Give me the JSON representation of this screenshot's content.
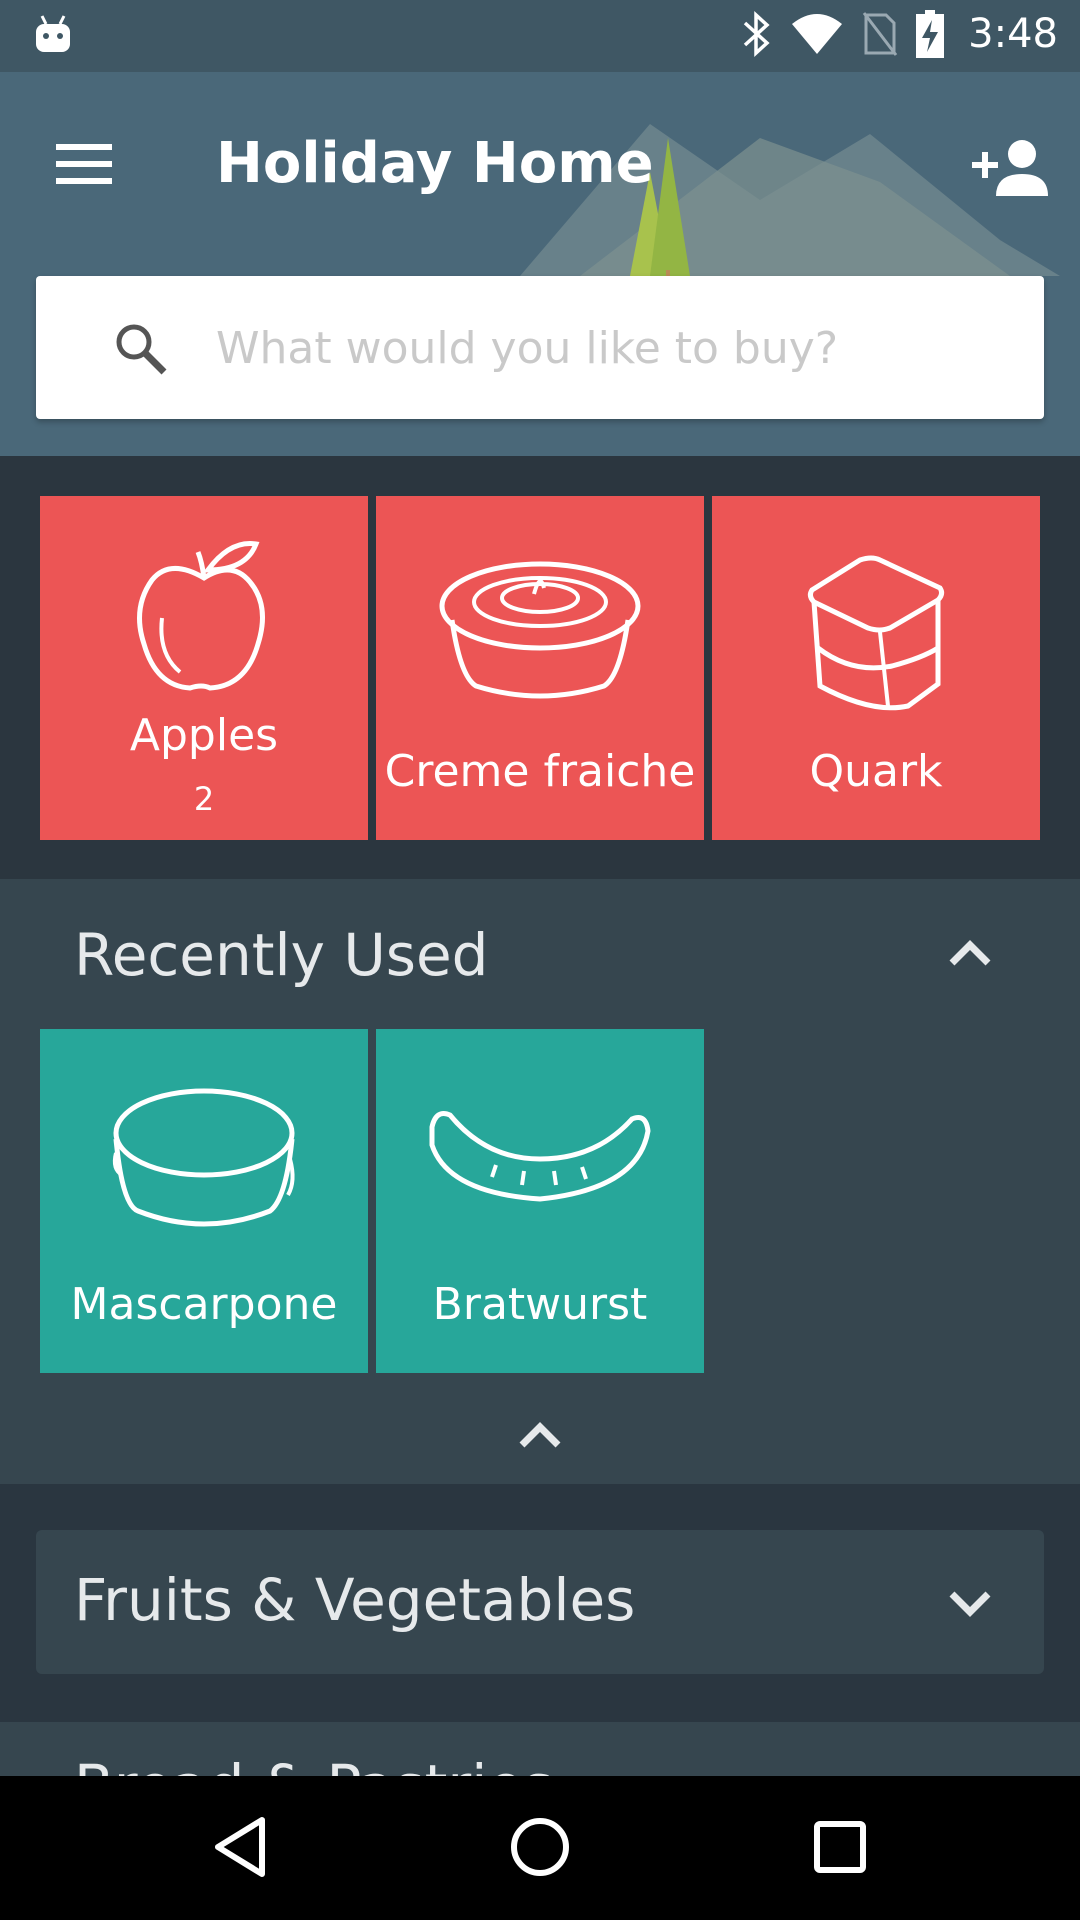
{
  "status_bar": {
    "time": "3:48",
    "icons": [
      "android-icon",
      "bluetooth-icon",
      "wifi-icon",
      "no-sim-icon",
      "battery-charging-icon"
    ]
  },
  "header": {
    "title": "Holiday Home",
    "menu_icon": "hamburger-menu-icon",
    "add_user_icon": "person-add-icon"
  },
  "search": {
    "placeholder": "What would you like to buy?",
    "value": ""
  },
  "shopping_list": {
    "items": [
      {
        "label": "Apples",
        "count": "2",
        "icon": "apple-icon"
      },
      {
        "label": "Creme fraiche",
        "icon": "creme-fraiche-icon"
      },
      {
        "label": "Quark",
        "icon": "quark-icon"
      }
    ],
    "tile_color": "#ec5555"
  },
  "recently_used": {
    "heading": "Recently Used",
    "items": [
      {
        "label": "Mascarpone",
        "icon": "mascarpone-icon"
      },
      {
        "label": "Bratwurst",
        "icon": "sausage-icon"
      }
    ],
    "tile_color": "#27a79a"
  },
  "categories": [
    {
      "label": "Fruits & Vegetables",
      "expanded": false
    },
    {
      "label": "Bread & Pastries",
      "expanded": false
    }
  ],
  "colors": {
    "header": "#4a6879",
    "status_bar": "#3f5764",
    "background": "#2a3640",
    "section": "#36464f"
  },
  "nav_bar": {
    "buttons": [
      "back-icon",
      "home-icon",
      "recents-icon"
    ]
  }
}
